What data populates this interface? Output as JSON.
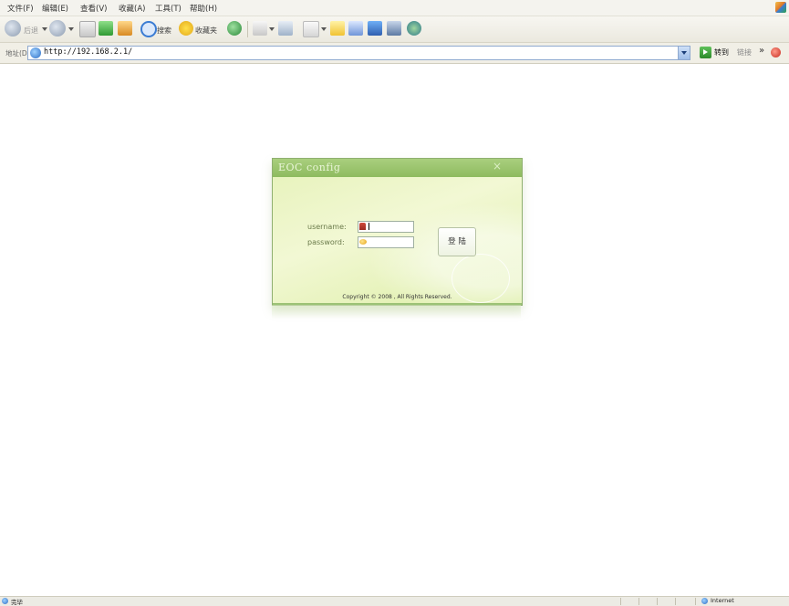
{
  "menu": {
    "items": [
      {
        "label": "文件(F)"
      },
      {
        "label": "编辑(E)"
      },
      {
        "label": "查看(V)"
      },
      {
        "label": "收藏(A)"
      },
      {
        "label": "工具(T)"
      },
      {
        "label": "帮助(H)"
      }
    ]
  },
  "toolbar": {
    "back_label": "后退",
    "search_label": "搜索",
    "favorites_label": "收藏夹"
  },
  "address_bar": {
    "label": "地址(D)",
    "url": "http://192.168.2.1/",
    "go_label": "转到",
    "links_label": "链接",
    "chevron": "»"
  },
  "dialog": {
    "title": "EOC config",
    "close_glyph": "×",
    "username_label": "username:",
    "password_label": "password:",
    "username_value": "",
    "password_value": "",
    "login_button": "登 陆",
    "copyright": "Copyright © 2008 , All Rights Reserved."
  },
  "status_bar": {
    "status": "完毕",
    "zone": "Internet"
  },
  "colors": {
    "dialog_title_bg": "#a9cf7e",
    "dialog_bg": "#eef6cc"
  }
}
